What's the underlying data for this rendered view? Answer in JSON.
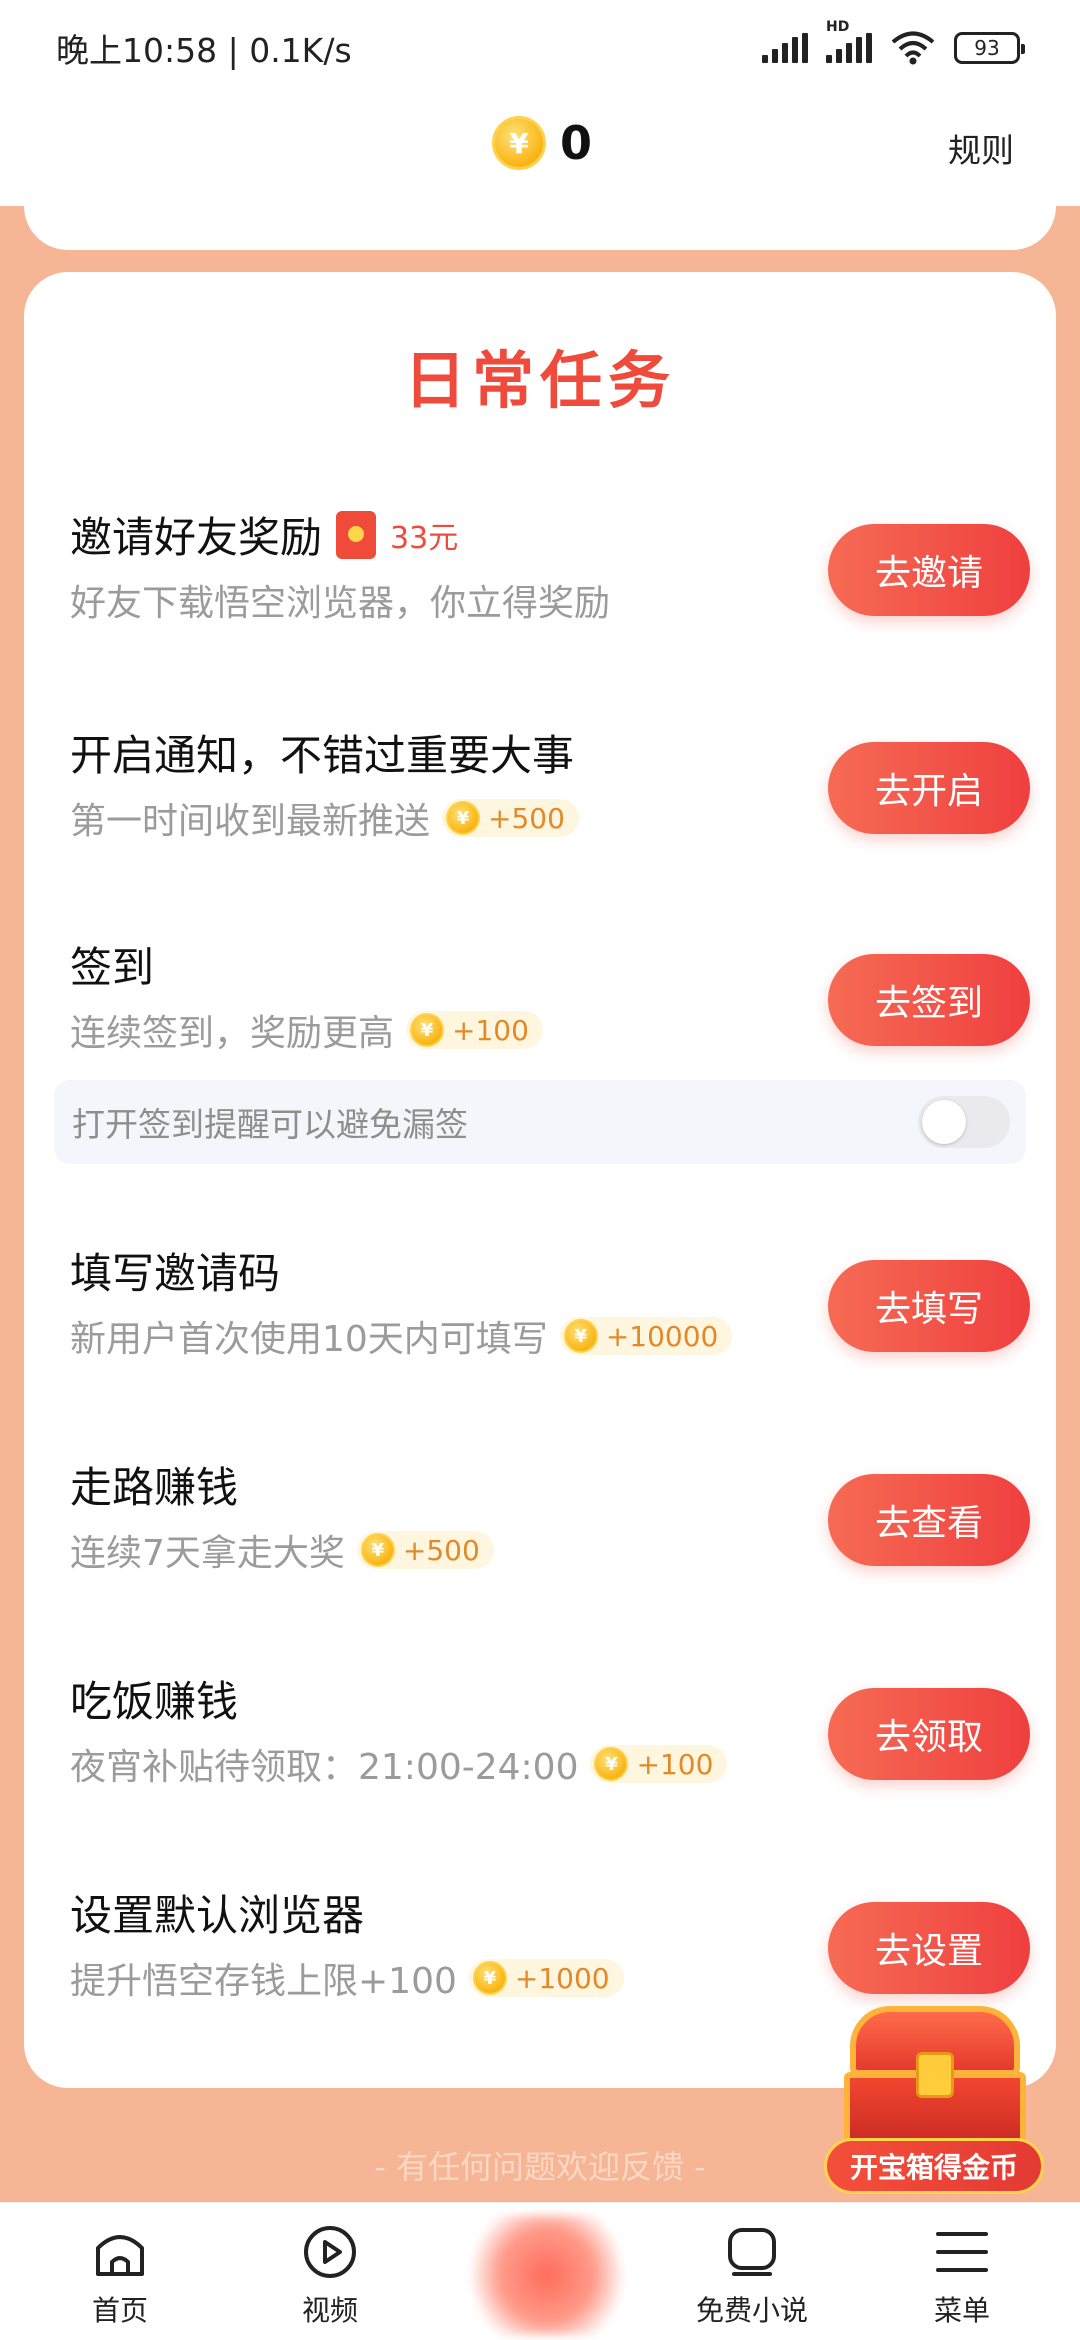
{
  "status_bar": {
    "time_speed": "晚上10:58 | 0.1K/s",
    "battery": "93"
  },
  "header": {
    "coin_symbol": "¥",
    "balance": "0",
    "rules_label": "规则"
  },
  "daily_tasks": {
    "title": "日常任务",
    "tasks": [
      {
        "title": "邀请好友奖励",
        "cash_reward": "33元",
        "description": "好友下载悟空浏览器，你立得奖励",
        "button_label": "去邀请"
      },
      {
        "title": "开启通知，不错过重要大事",
        "description": "第一时间收到最新推送",
        "reward": "+500",
        "button_label": "去开启"
      },
      {
        "title": "签到",
        "description": "连续签到，奖励更高",
        "reward": "+100",
        "button_label": "去签到"
      },
      {
        "title": "填写邀请码",
        "description": "新用户首次使用10天内可填写",
        "reward": "+10000",
        "button_label": "去填写"
      },
      {
        "title": "走路赚钱",
        "description": "连续7天拿走大奖",
        "reward": "+500",
        "button_label": "去查看"
      },
      {
        "title": "吃饭赚钱",
        "description": "夜宵补贴待领取：21:00-24:00",
        "reward": "+100",
        "button_label": "去领取"
      },
      {
        "title": "设置默认浏览器",
        "description": "提升悟空存钱上限+100",
        "reward": "+1000",
        "button_label": "去设置"
      }
    ],
    "reminder": {
      "text": "打开签到提醒可以避免漏签",
      "enabled": false
    }
  },
  "treasure_label": "开宝箱得金币",
  "feedback_text": "- 有任何问题欢迎反馈 -",
  "bottom_nav": {
    "items": [
      {
        "label": "首页",
        "icon": "home-icon"
      },
      {
        "label": "视频",
        "icon": "video-play-icon"
      },
      {
        "label": "免费小说",
        "icon": "book-icon"
      },
      {
        "label": "菜单",
        "icon": "menu-icon"
      }
    ]
  },
  "colors": {
    "accent_red": "#ef4b3c",
    "page_background": "#f6b594",
    "reward_orange": "#e2892a"
  }
}
